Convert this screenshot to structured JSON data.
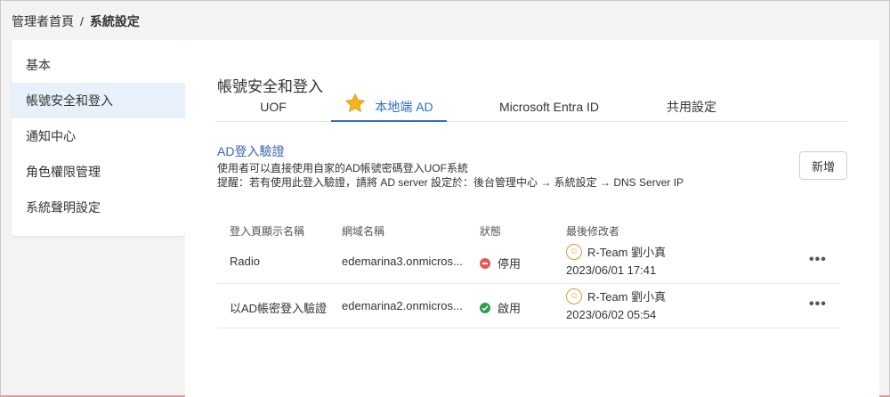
{
  "breadcrumb": {
    "home": "管理者首頁",
    "separator": "/",
    "current": "系統設定"
  },
  "sidebar": {
    "items": [
      {
        "label": "基本"
      },
      {
        "label": "帳號安全和登入"
      },
      {
        "label": "通知中心"
      },
      {
        "label": "角色權限管理"
      },
      {
        "label": "系統聲明設定"
      }
    ]
  },
  "main": {
    "title": "帳號安全和登入",
    "tabs": [
      {
        "label": "UOF"
      },
      {
        "label": "本地端 AD"
      },
      {
        "label": "Microsoft Entra ID"
      },
      {
        "label": "共用設定"
      }
    ],
    "section_title": "AD登入驗證",
    "desc_line1": "使用者可以直接使用自家的AD帳號密碼登入UOF系統",
    "desc_line2": "提醒：若有使用此登入驗證，請將 AD server 設定於：後台管理中心 → 系統設定 → DNS Server IP",
    "add_button": "新增"
  },
  "table": {
    "headers": {
      "name": "登入頁顯示名稱",
      "domain": "網域名稱",
      "status": "狀態",
      "modifier": "最後修改者"
    },
    "rows": [
      {
        "name": "Radio",
        "domain": "edemarina3.onmicros...",
        "status": "停用",
        "status_icon": "stop-icon",
        "modifier": "R-Team 劉小真",
        "modified": "2023/06/01 17:41",
        "more": "•••"
      },
      {
        "name": "以AD帳密登入驗證",
        "domain": "edemarina2.onmicros...",
        "status": "啟用",
        "status_icon": "check-icon",
        "modifier": "R-Team 劉小真",
        "modified": "2023/06/02 05:54",
        "more": "•••"
      }
    ]
  },
  "colors": {
    "accent": "#2f6ad3",
    "active_bg": "#e8f0fb",
    "disabled": "#e05a5a",
    "enabled": "#2e9e4e",
    "star": "#f2b51e"
  }
}
